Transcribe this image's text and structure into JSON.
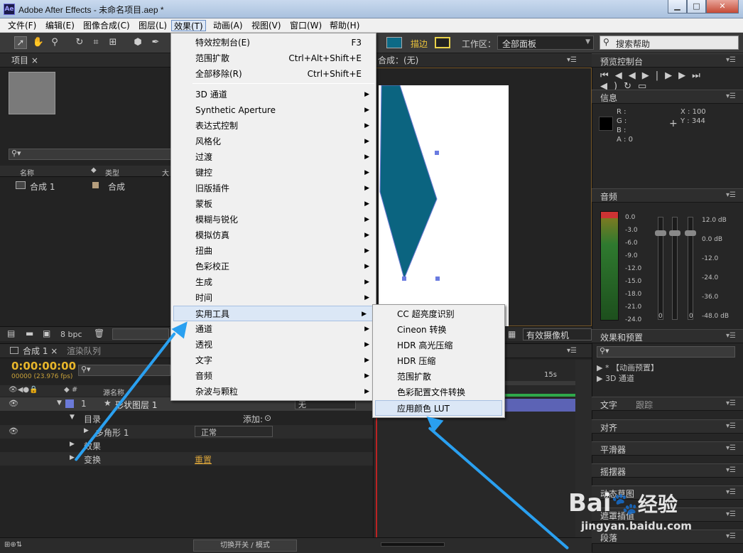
{
  "window": {
    "title": "Adobe After Effects - 未命名项目.aep *",
    "app_icon": "Ae",
    "min_glyph": "▁",
    "max_glyph": "□",
    "close_glyph": "✕"
  },
  "menubar": [
    "文件(F)",
    "编辑(E)",
    "图像合成(C)",
    "图层(L)",
    "效果(T)",
    "动画(A)",
    "视图(V)",
    "窗口(W)",
    "帮助(H)"
  ],
  "toolbar": {
    "stroke_label": "描边",
    "workspace_label": "工作区：",
    "workspace_value": "全部面板",
    "search_placeholder": "搜索帮助",
    "fill_color": "#0d6a86",
    "stroke_color": "#e9d24a"
  },
  "project": {
    "tab": "项目",
    "col_name": "名称",
    "col_type": "类型",
    "col_size": "大",
    "item_name": "合成 1",
    "item_type": "合成",
    "bpc": "8 bpc"
  },
  "viewer": {
    "tab_label": "合成：(无)",
    "camera": "有效摄像机",
    "shape_color": "#0b6480"
  },
  "effects_menu": {
    "items": [
      {
        "label": "特效控制台(E)",
        "shortcut": "F3"
      },
      {
        "label": "范围扩散",
        "shortcut": "Ctrl+Alt+Shift+E"
      },
      {
        "label": "全部移除(R)",
        "shortcut": "Ctrl+Shift+E"
      },
      {
        "label": "3D 通道",
        "sub": true
      },
      {
        "label": "Synthetic Aperture",
        "sub": true
      },
      {
        "label": "表达式控制",
        "sub": true
      },
      {
        "label": "风格化",
        "sub": true
      },
      {
        "label": "过渡",
        "sub": true
      },
      {
        "label": "键控",
        "sub": true
      },
      {
        "label": "旧版插件",
        "sub": true
      },
      {
        "label": "蒙板",
        "sub": true
      },
      {
        "label": "模糊与锐化",
        "sub": true
      },
      {
        "label": "模拟仿真",
        "sub": true
      },
      {
        "label": "扭曲",
        "sub": true
      },
      {
        "label": "色彩校正",
        "sub": true
      },
      {
        "label": "生成",
        "sub": true
      },
      {
        "label": "时间",
        "sub": true
      },
      {
        "label": "实用工具",
        "sub": true,
        "active": true
      },
      {
        "label": "通道",
        "sub": true
      },
      {
        "label": "透视",
        "sub": true
      },
      {
        "label": "文字",
        "sub": true
      },
      {
        "label": "音频",
        "sub": true
      },
      {
        "label": "杂波与颗粒",
        "sub": true
      }
    ]
  },
  "utility_submenu": {
    "items": [
      "CC 超亮度识别",
      "Cineon 转换",
      "HDR 高光压缩",
      "HDR 压缩",
      "范围扩散",
      "色彩配置文件转换",
      "应用颜色 LUT"
    ],
    "selected": "应用颜色 LUT"
  },
  "timeline": {
    "tab_comp": "合成 1",
    "tab_render": "渲染队列",
    "timecode": "0:00:00:00",
    "fps": "00000 (23.976 fps)",
    "col_source": "源名称",
    "layer_num": "1",
    "layer_name": "形状图层 1",
    "row_contents": "目录",
    "add_label": "添加:",
    "polygon": "多角形 1",
    "mode_value": "正常",
    "effects_row": "效果",
    "transform_row": "变换",
    "reset": "重置",
    "none_value": "无",
    "time_mark": "15s",
    "bottom_label": "切换开关 / 模式"
  },
  "preview": {
    "tab": "预览控制台"
  },
  "info": {
    "tab": "信息",
    "r": "R :",
    "g": "G :",
    "b": "B :",
    "a": "A : 0",
    "x": "X : 100",
    "y": "Y : 344"
  },
  "audio": {
    "tab": "音频",
    "left_scale": [
      "0.0",
      "-3.0",
      "-6.0",
      "-9.0",
      "-12.0",
      "-15.0",
      "-18.0",
      "-21.0",
      "-24.0"
    ],
    "right_scale": [
      "12.0 dB",
      "0.0 dB",
      "-12.0",
      "-24.0",
      "-36.0",
      "-48.0 dB"
    ],
    "zero": "0"
  },
  "effects_presets": {
    "tab": "效果和预置",
    "item1": "* 【动画预置】",
    "item2": "3D 通道"
  },
  "side_panels": [
    "文字",
    "跟踪",
    "对齐",
    "平滑器",
    "摇摆器",
    "动态草图",
    "遮罩插值",
    "段落"
  ],
  "watermark": {
    "brand": "Bai",
    "brand2": "经验",
    "url": "jingyan.baidu.com"
  }
}
